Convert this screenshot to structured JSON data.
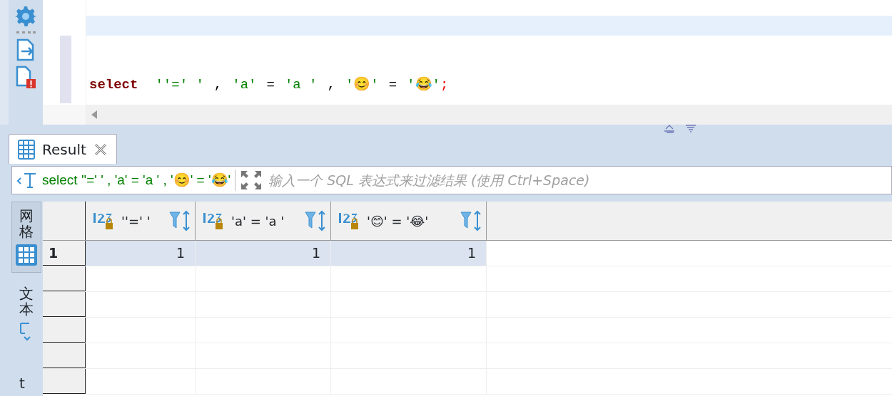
{
  "editor": {
    "code_tokens": [
      {
        "kind": "keyword",
        "text": "select"
      },
      {
        "kind": "string",
        "text": "''=' '"
      },
      {
        "kind": "plain",
        "text": ","
      },
      {
        "kind": "string",
        "text": "'a'"
      },
      {
        "kind": "plain",
        "text": "="
      },
      {
        "kind": "string",
        "text": "'a '"
      },
      {
        "kind": "plain",
        "text": ","
      },
      {
        "kind": "string",
        "text": "'😊'"
      },
      {
        "kind": "plain",
        "text": "="
      },
      {
        "kind": "string",
        "text": "'😂'"
      },
      {
        "kind": "terminator",
        "text": ";"
      }
    ]
  },
  "result_tabs": [
    {
      "label": "Result",
      "selected": true
    }
  ],
  "filter": {
    "query": "select ''=' ' , 'a' = 'a ' , '😊' = '😂'",
    "placeholder": "输入一个 SQL 表达式来过滤结果 (使用 Ctrl+Space)"
  },
  "view_tabs": [
    {
      "label": "网格",
      "kind": "grid",
      "selected": true
    },
    {
      "label": "文本",
      "kind": "text",
      "selected": false
    },
    {
      "label": "t",
      "kind": "cut",
      "selected": false
    }
  ],
  "table": {
    "columns": [
      "''=' '",
      "'a' = 'a '",
      "'😊' = '😂'"
    ],
    "rows": [
      {
        "number": "1",
        "cells": [
          "1",
          "1",
          "1"
        ],
        "selected": true
      }
    ]
  }
}
